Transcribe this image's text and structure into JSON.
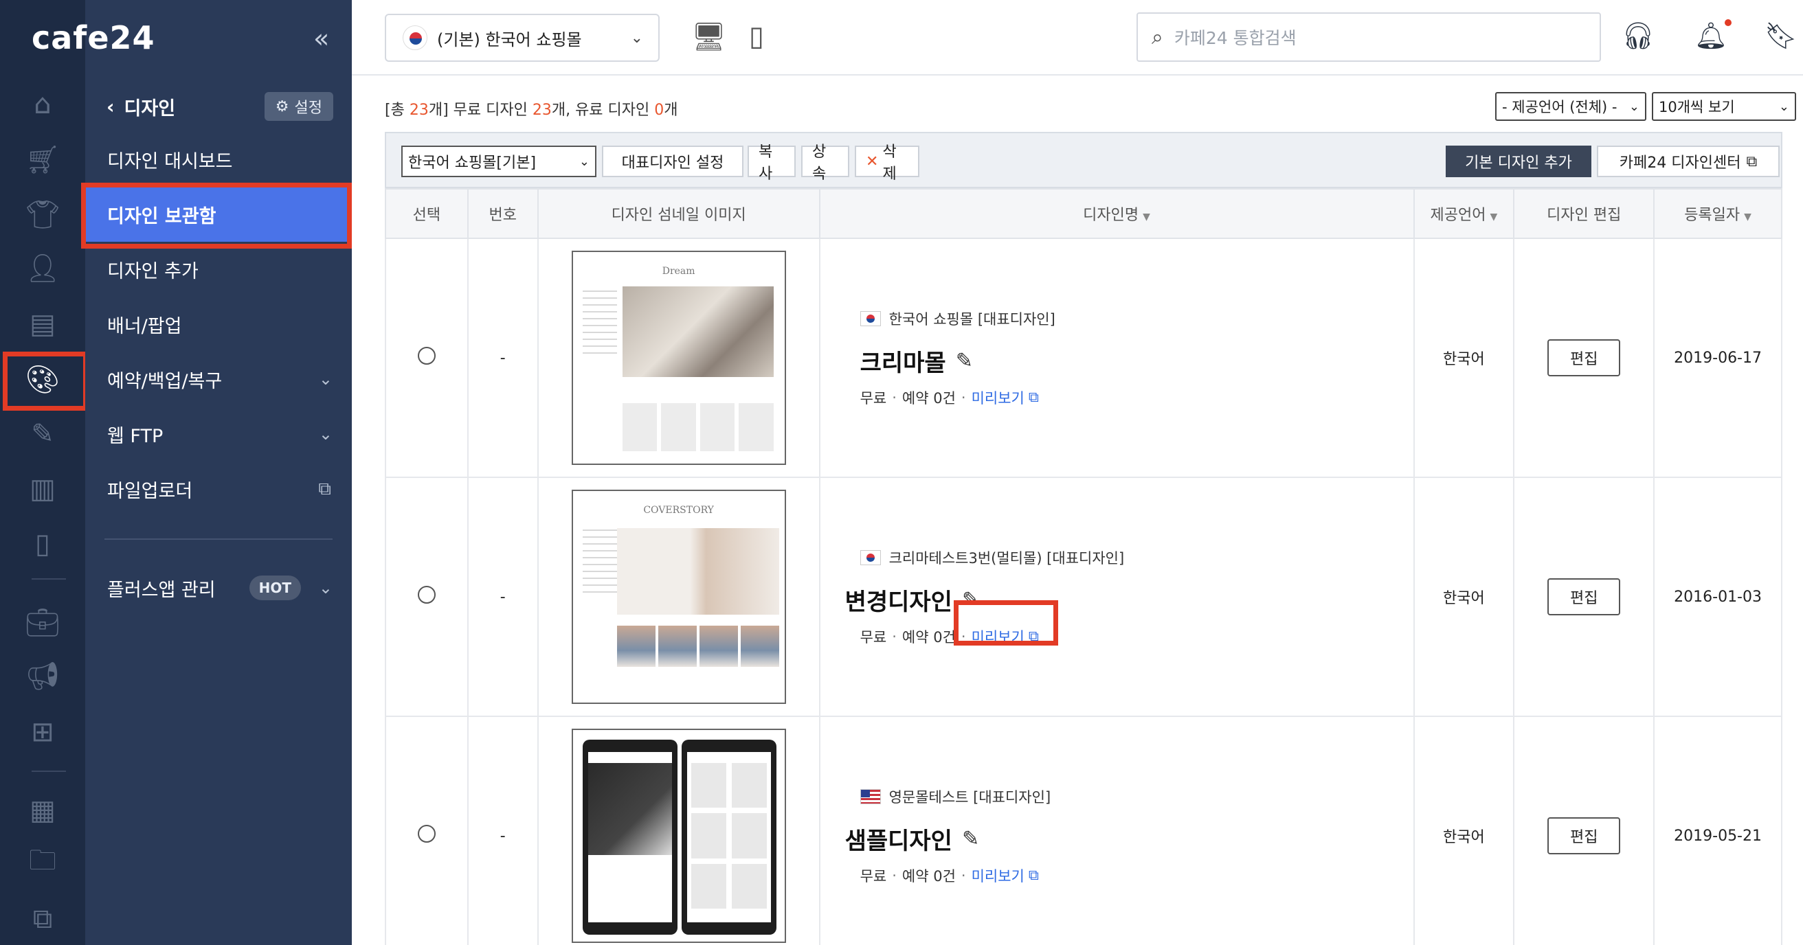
{
  "brand": {
    "logo": "cafe24",
    "collapse": "«"
  },
  "rail": {
    "icons": [
      "home-icon",
      "cart-icon",
      "shirt-icon",
      "user-icon",
      "list-icon",
      "palette-icon",
      "coupon-icon",
      "stats-icon",
      "mobile-icon",
      "briefcase-icon",
      "megaphone-icon",
      "store-add-icon",
      "apps-icon",
      "folder-add-icon",
      "copy-icon"
    ]
  },
  "nav": {
    "title": "디자인",
    "back": "‹",
    "settings_label": "설정",
    "items": [
      {
        "label": "디자인 대시보드"
      },
      {
        "label": "디자인 보관함"
      },
      {
        "label": "디자인 추가"
      },
      {
        "label": "배너/팝업"
      },
      {
        "label": "예약/백업/복구"
      },
      {
        "label": "웹 FTP"
      },
      {
        "label": "파일업로더"
      }
    ],
    "plus_app": {
      "label": "플러스앱 관리",
      "badge": "HOT"
    }
  },
  "topbar": {
    "shop_select": "(기본) 한국어 쇼핑몰",
    "search_placeholder": "카페24 통합검색"
  },
  "summary": {
    "prefix": "[총 ",
    "total": "23",
    "mid1": "개] 무료 디자인 ",
    "free": "23",
    "mid2": "개, 유료 디자인 ",
    "paid": "0",
    "suffix": "개"
  },
  "filters": {
    "language": "- 제공언어 (전체) -",
    "per_page": "10개씩 보기"
  },
  "toolbar": {
    "shop_select": "한국어 쇼핑몰[기본]",
    "set_main": "대표디자인 설정",
    "copy": "복사",
    "inherit": "상속",
    "delete": "삭제",
    "add_basic": "기본 디자인 추가",
    "design_center": "카페24 디자인센터"
  },
  "table": {
    "headers": [
      "선택",
      "번호",
      "디자인 섬네일 이미지",
      "디자인명",
      "제공언어",
      "디자인 편집",
      "등록일자"
    ],
    "rows": [
      {
        "no": "-",
        "shop": "한국어 쇼핑몰 [대표디자인]",
        "flag": "kr",
        "name": "크리마몰",
        "price": "무료",
        "reserve": "예약 0건",
        "preview": "미리보기",
        "thumb_brand": "Dream",
        "language": "한국어",
        "edit": "편집",
        "date": "2019-06-17"
      },
      {
        "no": "-",
        "shop": "크리마테스트3번(멀티몰) [대표디자인]",
        "flag": "kr",
        "name": "변경디자인",
        "price": "무료",
        "reserve": "예약 0건",
        "preview": "미리보기",
        "thumb_brand": "COVERSTORY",
        "language": "한국어",
        "edit": "편집",
        "date": "2016-01-03"
      },
      {
        "no": "-",
        "shop": "영문몰테스트 [대표디자인]",
        "flag": "us",
        "name": "샘플디자인",
        "price": "무료",
        "reserve": "예약 0건",
        "preview": "미리보기",
        "thumb_brand": "",
        "language": "한국어",
        "edit": "편집",
        "date": "2019-05-21"
      }
    ]
  },
  "colors": {
    "rail_bg": "#1d2b44",
    "panel_bg": "#2a3a58",
    "selected": "#4a73e8",
    "highlight": "#e23b25",
    "count": "#e8562e",
    "link": "#2d6ae3"
  }
}
